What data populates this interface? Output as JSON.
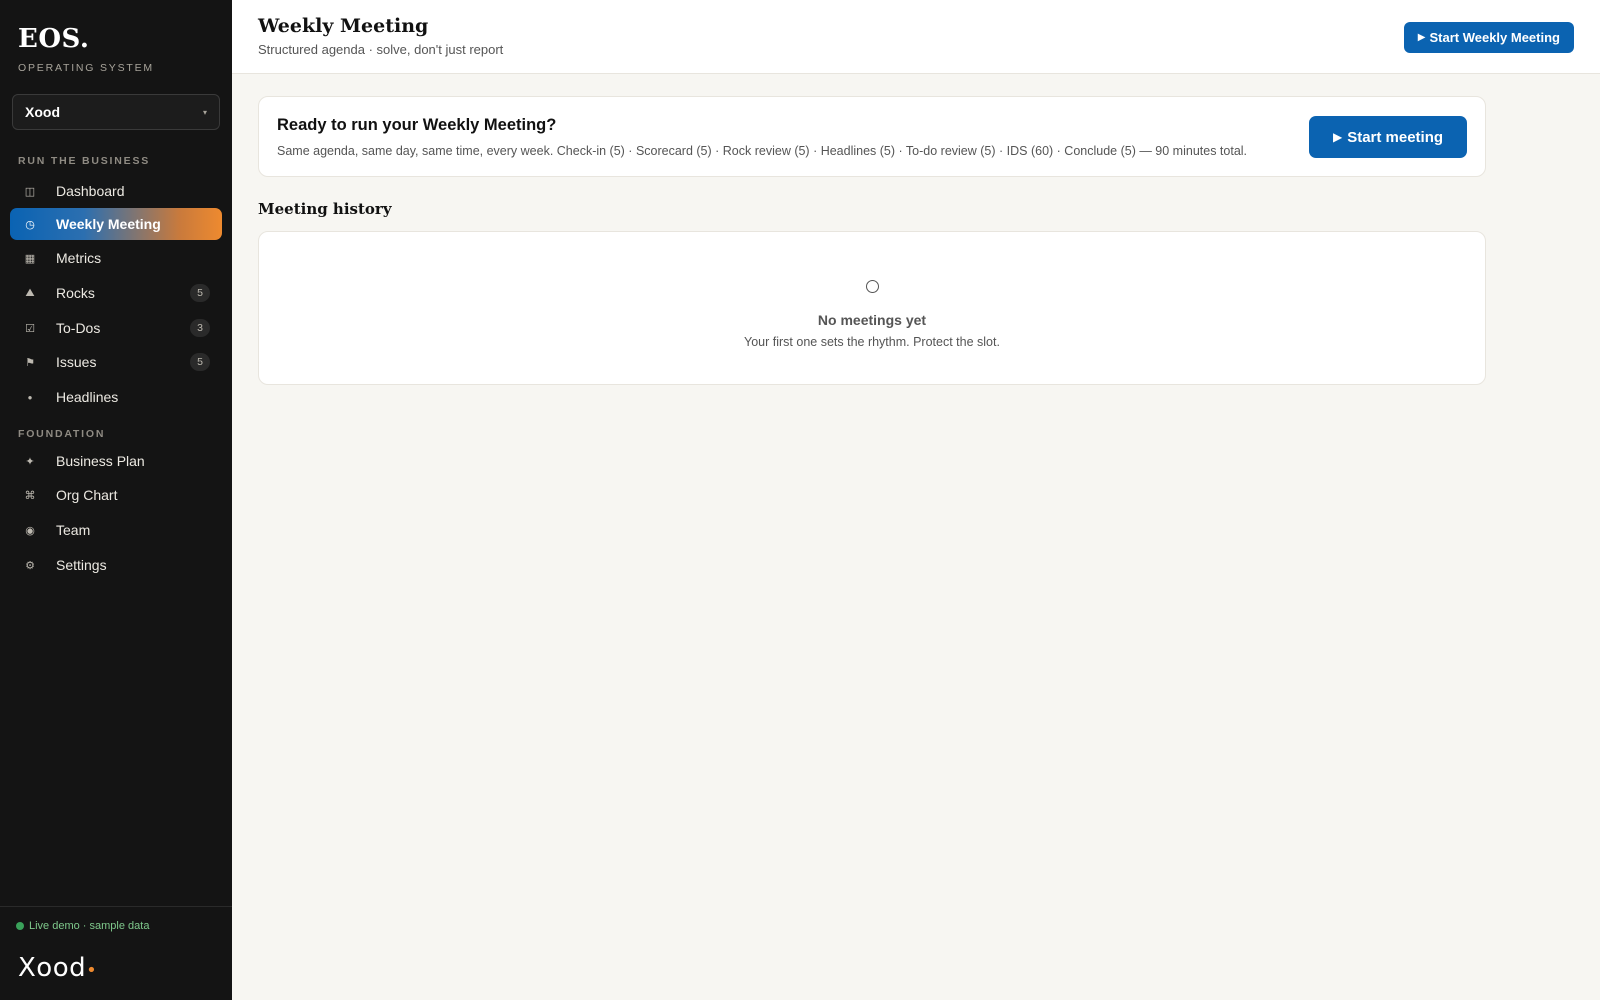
{
  "brand": {
    "name": "EOS.",
    "subtitle": "OPERATING SYSTEM"
  },
  "org_select": {
    "value": "Xood",
    "caret": "▾"
  },
  "sidebar": {
    "sections": [
      {
        "label": "RUN THE BUSINESS",
        "items": [
          {
            "label": "Dashboard",
            "icon": "dashboard-icon",
            "glyph": "◫",
            "badge": ""
          },
          {
            "label": "Weekly Meeting",
            "icon": "clock-icon",
            "glyph": "◷",
            "badge": "",
            "active": true
          },
          {
            "label": "Metrics",
            "icon": "grid-icon",
            "glyph": "▦",
            "badge": ""
          },
          {
            "label": "Rocks",
            "icon": "mountain-icon",
            "glyph": "⛰",
            "badge": "5"
          },
          {
            "label": "To-Dos",
            "icon": "checkbox-icon",
            "glyph": "☑",
            "badge": "3"
          },
          {
            "label": "Issues",
            "icon": "flag-icon",
            "glyph": "⚑",
            "badge": "5"
          },
          {
            "label": "Headlines",
            "icon": "megaphone-icon",
            "glyph": "●",
            "badge": ""
          }
        ]
      },
      {
        "label": "FOUNDATION",
        "items": [
          {
            "label": "Business Plan",
            "icon": "star-icon",
            "glyph": "✦",
            "badge": ""
          },
          {
            "label": "Org Chart",
            "icon": "org-chart-icon",
            "glyph": "⌘",
            "badge": ""
          },
          {
            "label": "Team",
            "icon": "team-icon",
            "glyph": "◉",
            "badge": ""
          },
          {
            "label": "Settings",
            "icon": "gear-icon",
            "glyph": "⚙",
            "badge": ""
          }
        ]
      }
    ],
    "footer": {
      "status": "Live demo · sample data",
      "logo": "Xood",
      "logo_dot": "•"
    }
  },
  "header": {
    "title": "Weekly Meeting",
    "subtitle": "Structured agenda · solve, don't just report",
    "primary_button": "Start Weekly Meeting",
    "play_glyph": "▶"
  },
  "ready": {
    "title": "Ready to run your Weekly Meeting?",
    "description": "Same agenda, same day, same time, every week. Check-in (5) · Scorecard (5) · Rock review (5) · Headlines (5) · To-do review (5) · IDS (60) · Conclude (5) — 90 minutes total.",
    "button": "Start meeting"
  },
  "history": {
    "title": "Meeting history",
    "empty_title": "No meetings yet",
    "empty_subtitle": "Your first one sets the rhythm. Protect the slot."
  },
  "colors": {
    "primary": "#0b63b1",
    "accent": "#ee8a2f",
    "sidebar_bg": "#141414",
    "page_bg": "#f7f6f2",
    "live": "#3aa15a"
  }
}
